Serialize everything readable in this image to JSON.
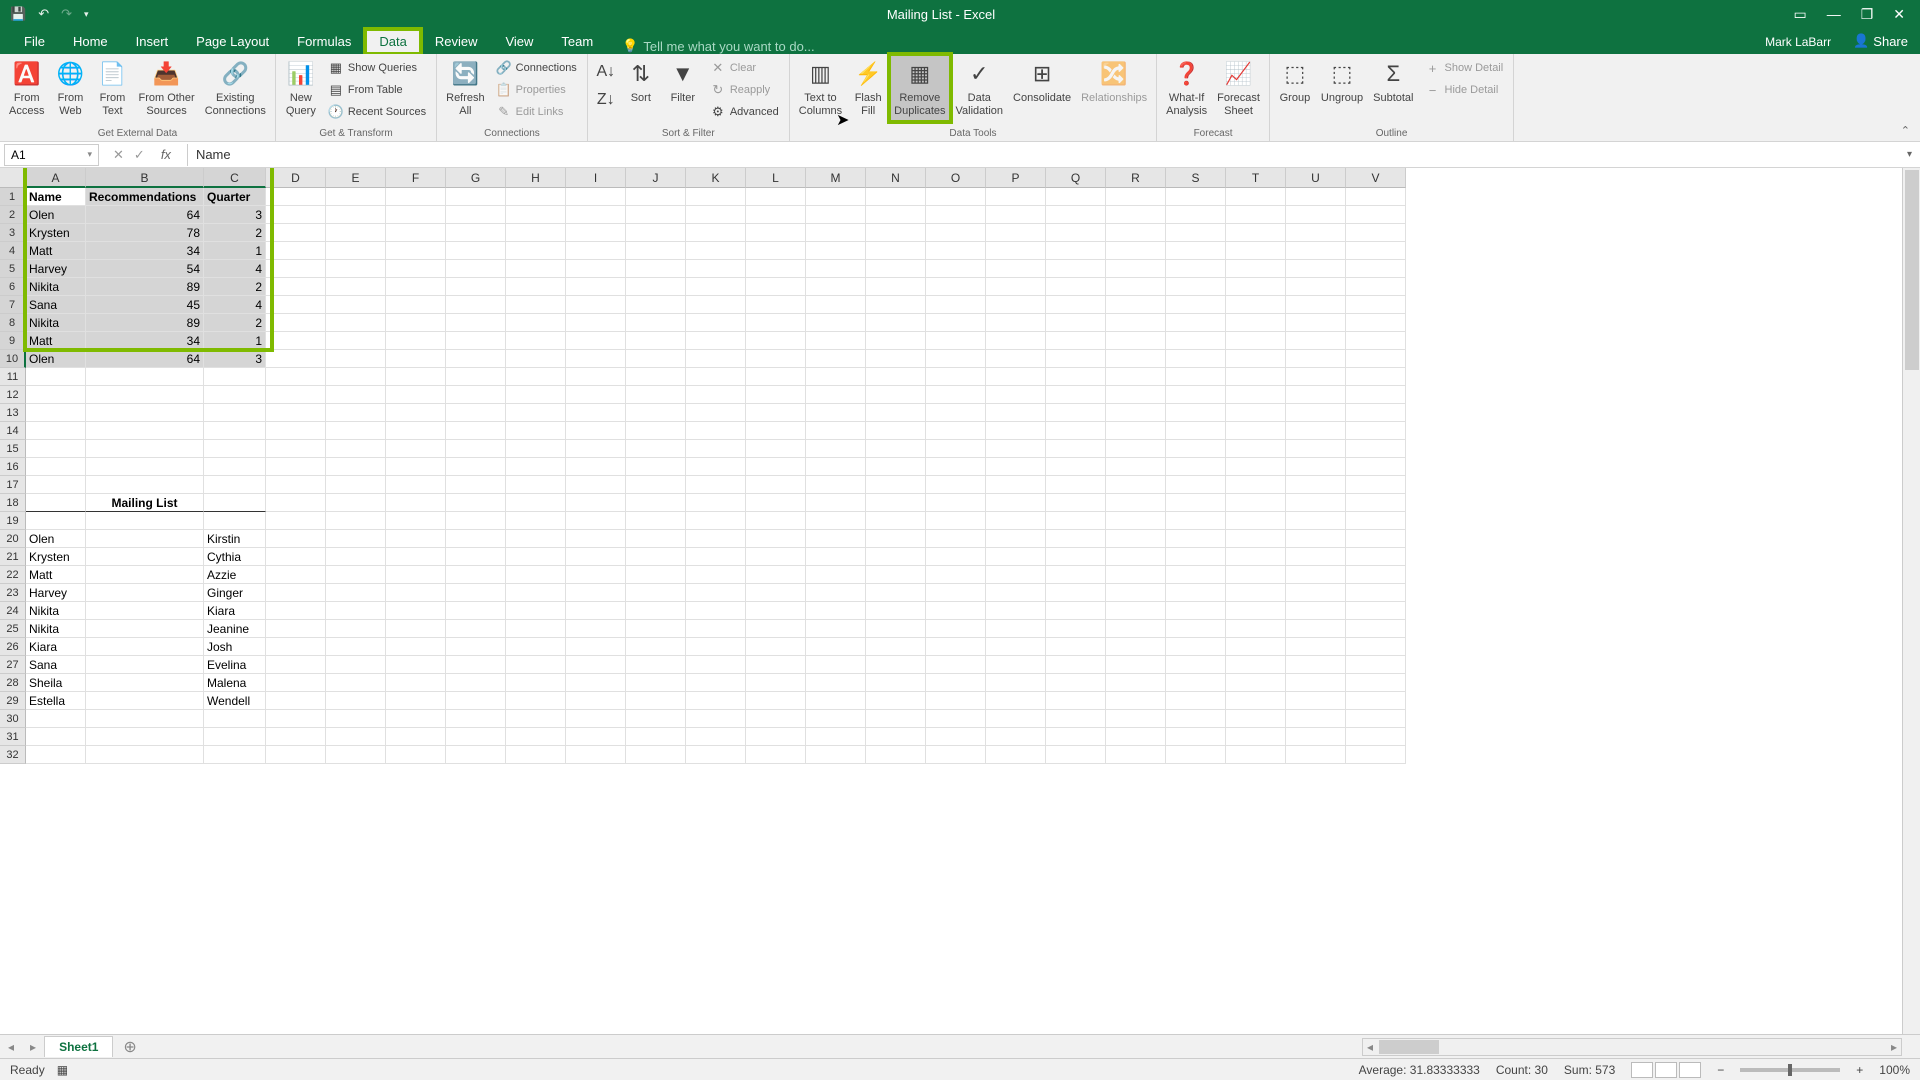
{
  "window": {
    "title": "Mailing List - Excel",
    "user": "Mark LaBarr",
    "share": "Share"
  },
  "tabs": [
    "File",
    "Home",
    "Insert",
    "Page Layout",
    "Formulas",
    "Data",
    "Review",
    "View",
    "Team"
  ],
  "active_tab": "Data",
  "tell_me": "Tell me what you want to do...",
  "ribbon": {
    "ext": {
      "label": "Get External Data",
      "from_access": "From\nAccess",
      "from_web": "From\nWeb",
      "from_text": "From\nText",
      "from_other": "From Other\nSources",
      "existing": "Existing\nConnections"
    },
    "transform": {
      "label": "Get & Transform",
      "new_query": "New\nQuery",
      "show_queries": "Show Queries",
      "from_table": "From Table",
      "recent": "Recent Sources"
    },
    "conn": {
      "label": "Connections",
      "refresh": "Refresh\nAll",
      "connections": "Connections",
      "properties": "Properties",
      "edit_links": "Edit Links"
    },
    "sort": {
      "label": "Sort & Filter",
      "sort": "Sort",
      "filter": "Filter",
      "clear": "Clear",
      "reapply": "Reapply",
      "advanced": "Advanced"
    },
    "tools": {
      "label": "Data Tools",
      "text_cols": "Text to\nColumns",
      "flash": "Flash\nFill",
      "remove_dup": "Remove\nDuplicates",
      "validation": "Data\nValidation",
      "consolidate": "Consolidate",
      "relationships": "Relationships"
    },
    "forecast": {
      "label": "Forecast",
      "whatif": "What-If\nAnalysis",
      "sheet": "Forecast\nSheet"
    },
    "outline": {
      "label": "Outline",
      "group": "Group",
      "ungroup": "Ungroup",
      "subtotal": "Subtotal",
      "show_detail": "Show Detail",
      "hide_detail": "Hide Detail"
    }
  },
  "name_box": "A1",
  "formula_value": "Name",
  "columns": [
    "A",
    "B",
    "C",
    "D",
    "E",
    "F",
    "G",
    "H",
    "I",
    "J",
    "K",
    "L",
    "M",
    "N",
    "O",
    "P",
    "Q",
    "R",
    "S",
    "T",
    "U",
    "V"
  ],
  "table": {
    "headers": [
      "Name",
      "Recommendations",
      "Quarter"
    ],
    "rows": [
      [
        "Olen",
        "64",
        "3"
      ],
      [
        "Krysten",
        "78",
        "2"
      ],
      [
        "Matt",
        "34",
        "1"
      ],
      [
        "Harvey",
        "54",
        "4"
      ],
      [
        "Nikita",
        "89",
        "2"
      ],
      [
        "Sana",
        "45",
        "4"
      ],
      [
        "Nikita",
        "89",
        "2"
      ],
      [
        "Matt",
        "34",
        "1"
      ],
      [
        "Olen",
        "64",
        "3"
      ]
    ]
  },
  "mailing": {
    "title": "Mailing List",
    "rows": [
      [
        "Olen",
        "",
        "Kirstin"
      ],
      [
        "Krysten",
        "",
        "Cythia"
      ],
      [
        "Matt",
        "",
        "Azzie"
      ],
      [
        "Harvey",
        "",
        "Ginger"
      ],
      [
        "Nikita",
        "",
        "Kiara"
      ],
      [
        "Nikita",
        "",
        "Jeanine"
      ],
      [
        "Kiara",
        "",
        "Josh"
      ],
      [
        "Sana",
        "",
        "Evelina"
      ],
      [
        "Sheila",
        "",
        "Malena"
      ],
      [
        "Estella",
        "",
        "Wendell"
      ]
    ]
  },
  "sheet_tab": "Sheet1",
  "status": {
    "ready": "Ready",
    "avg": "Average: 31.83333333",
    "count": "Count: 30",
    "sum": "Sum: 573",
    "zoom": "100%"
  }
}
